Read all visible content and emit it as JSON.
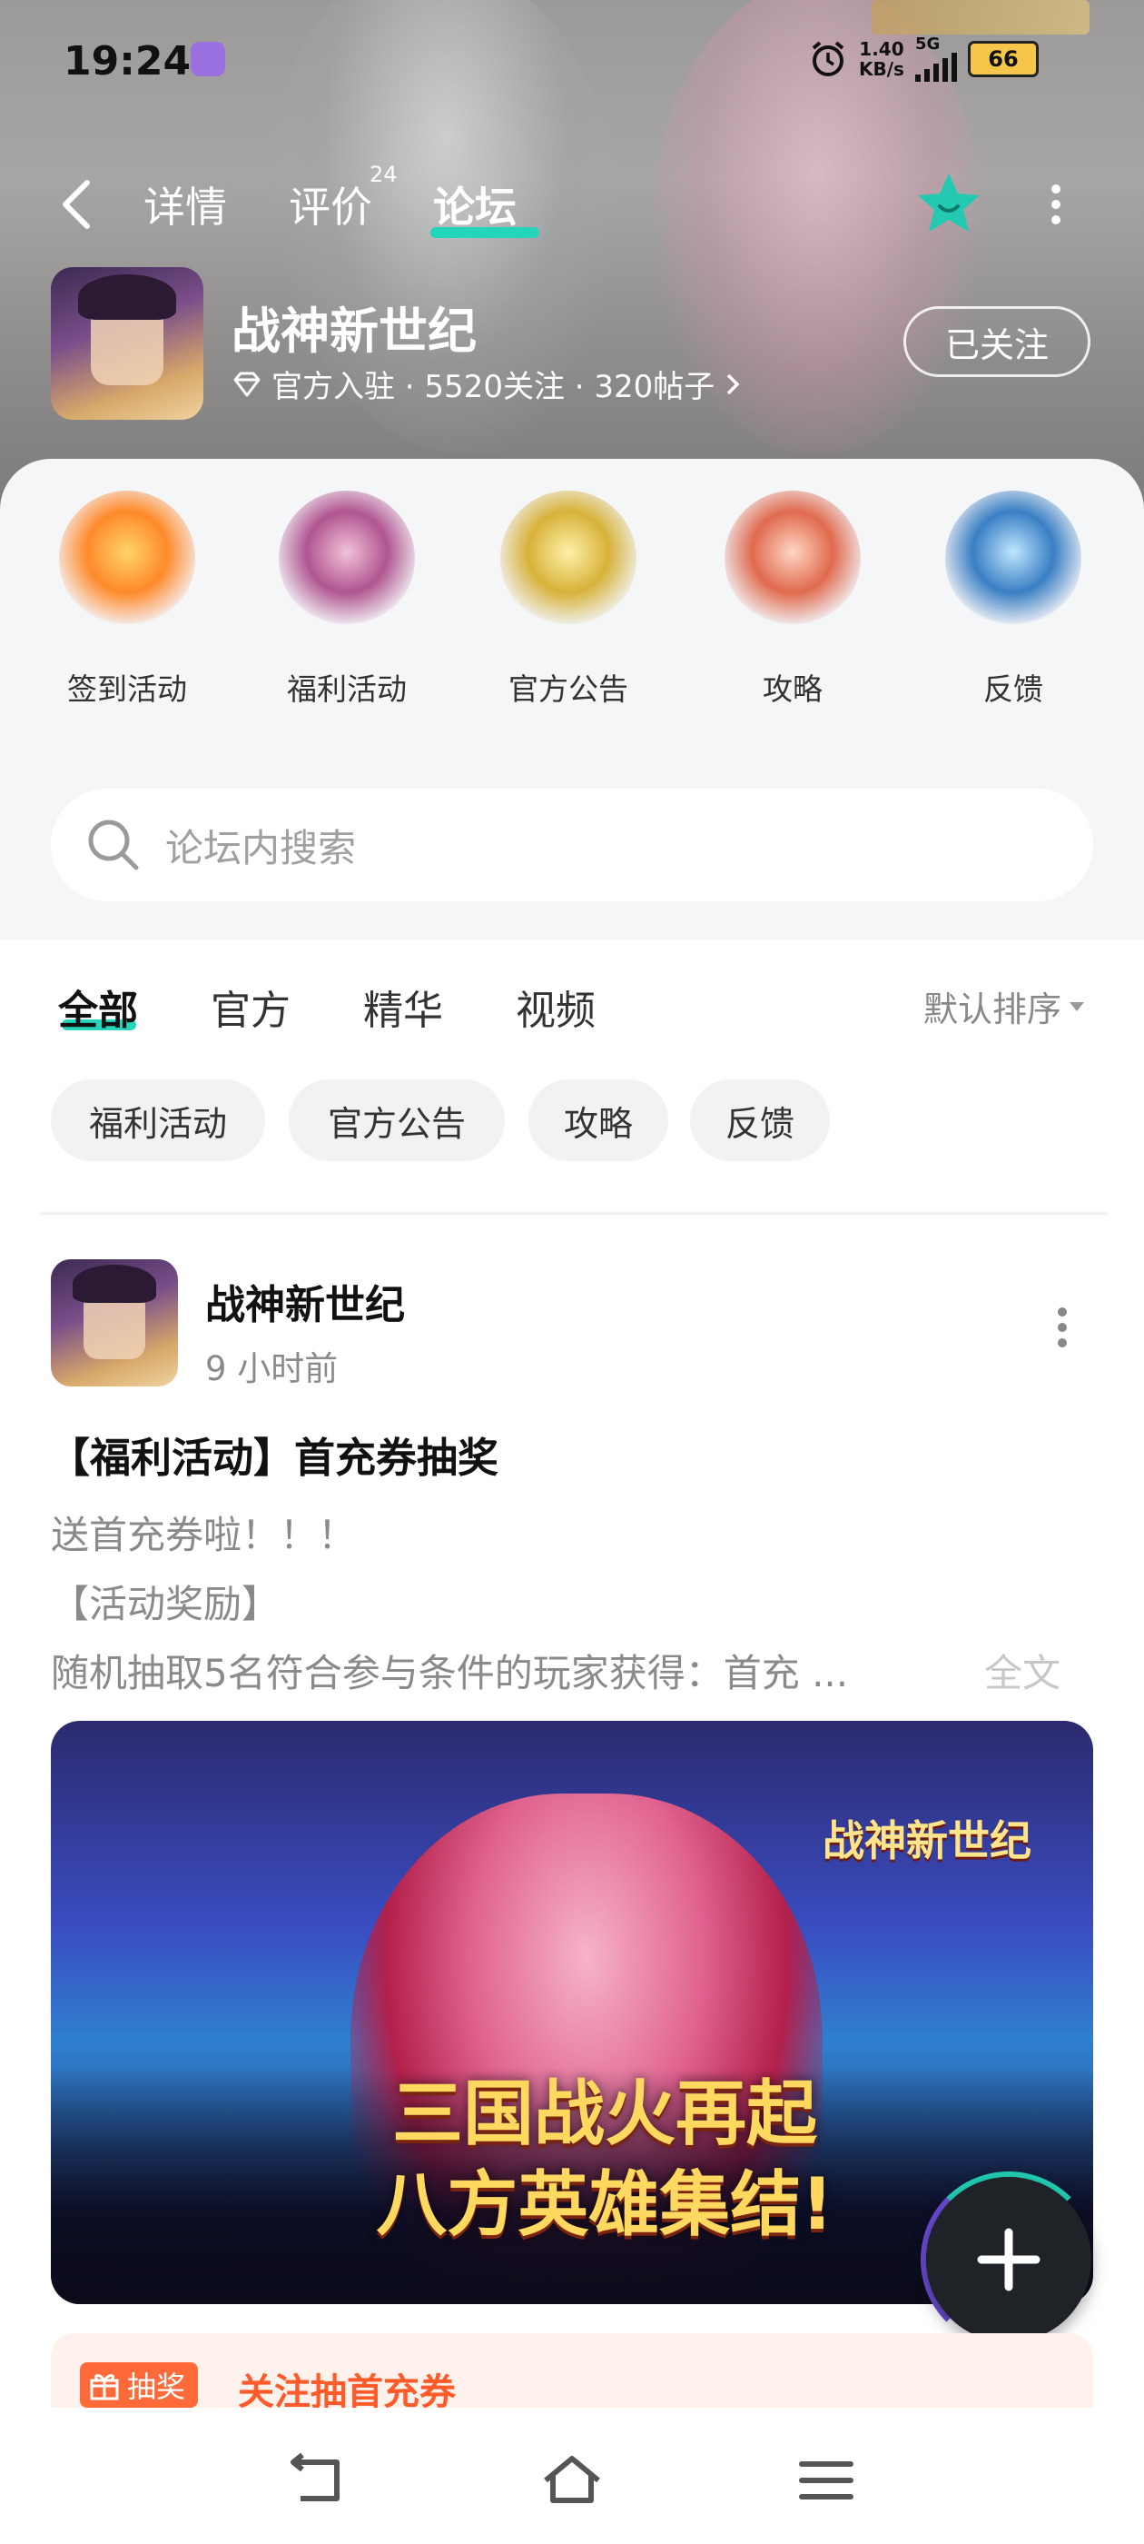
{
  "status_bar": {
    "time": "19:24",
    "speed_value": "1.40",
    "speed_unit": "KB/s",
    "network": "5G",
    "battery": "66",
    "icons": [
      "app-notification-icon",
      "alarm-icon",
      "signal-icon",
      "battery-icon"
    ]
  },
  "top_nav": {
    "tabs": [
      {
        "label": "详情"
      },
      {
        "label": "评价",
        "badge": "24"
      },
      {
        "label": "论坛",
        "active": true
      }
    ],
    "icons": [
      "back-icon",
      "favorite-icon",
      "more-vertical-icon"
    ]
  },
  "game": {
    "name": "战神新世纪",
    "meta": "官方入驻 · 5520关注 · 320帖子",
    "follow_label": "已关注"
  },
  "categories": [
    {
      "label": "签到活动"
    },
    {
      "label": "福利活动"
    },
    {
      "label": "官方公告"
    },
    {
      "label": "攻略"
    },
    {
      "label": "反馈"
    }
  ],
  "search": {
    "placeholder": "论坛内搜索"
  },
  "filter_tabs": [
    {
      "label": "全部",
      "active": true
    },
    {
      "label": "官方"
    },
    {
      "label": "精华"
    },
    {
      "label": "视频"
    }
  ],
  "sort": {
    "label": "默认排序"
  },
  "chips": [
    {
      "label": "福利活动"
    },
    {
      "label": "官方公告"
    },
    {
      "label": "攻略"
    },
    {
      "label": "反馈"
    }
  ],
  "post": {
    "author": "战神新世纪",
    "time": "9 小时前",
    "title": "【福利活动】首充券抽奖",
    "lines": [
      "送首充券啦！！！",
      "【活动奖励】",
      "随机抽取5名符合参与条件的玩家获得：首充 ..."
    ],
    "full_text_label": "全文",
    "banner": {
      "logo": "战神新世纪",
      "slogan_line1": "三国战火再起",
      "slogan_line2": "八方英雄集结!"
    },
    "promo_badge": "抽奖",
    "promo_text": "关注抽首充券"
  },
  "colors": {
    "accent": "#24d5bb",
    "promo": "#ff5a2a"
  }
}
